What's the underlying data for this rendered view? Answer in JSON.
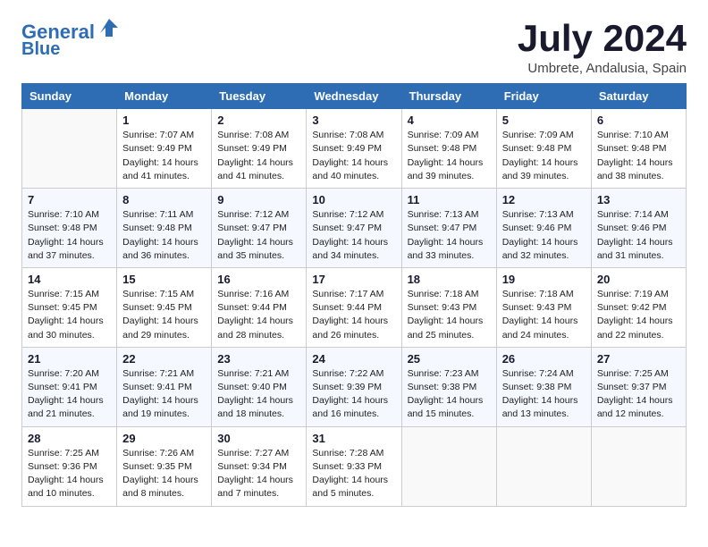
{
  "header": {
    "logo_line1": "General",
    "logo_line2": "Blue",
    "month_year": "July 2024",
    "location": "Umbrete, Andalusia, Spain"
  },
  "weekdays": [
    "Sunday",
    "Monday",
    "Tuesday",
    "Wednesday",
    "Thursday",
    "Friday",
    "Saturday"
  ],
  "weeks": [
    [
      {
        "day": "",
        "info": ""
      },
      {
        "day": "1",
        "info": "Sunrise: 7:07 AM\nSunset: 9:49 PM\nDaylight: 14 hours\nand 41 minutes."
      },
      {
        "day": "2",
        "info": "Sunrise: 7:08 AM\nSunset: 9:49 PM\nDaylight: 14 hours\nand 41 minutes."
      },
      {
        "day": "3",
        "info": "Sunrise: 7:08 AM\nSunset: 9:49 PM\nDaylight: 14 hours\nand 40 minutes."
      },
      {
        "day": "4",
        "info": "Sunrise: 7:09 AM\nSunset: 9:48 PM\nDaylight: 14 hours\nand 39 minutes."
      },
      {
        "day": "5",
        "info": "Sunrise: 7:09 AM\nSunset: 9:48 PM\nDaylight: 14 hours\nand 39 minutes."
      },
      {
        "day": "6",
        "info": "Sunrise: 7:10 AM\nSunset: 9:48 PM\nDaylight: 14 hours\nand 38 minutes."
      }
    ],
    [
      {
        "day": "7",
        "info": "Sunrise: 7:10 AM\nSunset: 9:48 PM\nDaylight: 14 hours\nand 37 minutes."
      },
      {
        "day": "8",
        "info": "Sunrise: 7:11 AM\nSunset: 9:48 PM\nDaylight: 14 hours\nand 36 minutes."
      },
      {
        "day": "9",
        "info": "Sunrise: 7:12 AM\nSunset: 9:47 PM\nDaylight: 14 hours\nand 35 minutes."
      },
      {
        "day": "10",
        "info": "Sunrise: 7:12 AM\nSunset: 9:47 PM\nDaylight: 14 hours\nand 34 minutes."
      },
      {
        "day": "11",
        "info": "Sunrise: 7:13 AM\nSunset: 9:47 PM\nDaylight: 14 hours\nand 33 minutes."
      },
      {
        "day": "12",
        "info": "Sunrise: 7:13 AM\nSunset: 9:46 PM\nDaylight: 14 hours\nand 32 minutes."
      },
      {
        "day": "13",
        "info": "Sunrise: 7:14 AM\nSunset: 9:46 PM\nDaylight: 14 hours\nand 31 minutes."
      }
    ],
    [
      {
        "day": "14",
        "info": "Sunrise: 7:15 AM\nSunset: 9:45 PM\nDaylight: 14 hours\nand 30 minutes."
      },
      {
        "day": "15",
        "info": "Sunrise: 7:15 AM\nSunset: 9:45 PM\nDaylight: 14 hours\nand 29 minutes."
      },
      {
        "day": "16",
        "info": "Sunrise: 7:16 AM\nSunset: 9:44 PM\nDaylight: 14 hours\nand 28 minutes."
      },
      {
        "day": "17",
        "info": "Sunrise: 7:17 AM\nSunset: 9:44 PM\nDaylight: 14 hours\nand 26 minutes."
      },
      {
        "day": "18",
        "info": "Sunrise: 7:18 AM\nSunset: 9:43 PM\nDaylight: 14 hours\nand 25 minutes."
      },
      {
        "day": "19",
        "info": "Sunrise: 7:18 AM\nSunset: 9:43 PM\nDaylight: 14 hours\nand 24 minutes."
      },
      {
        "day": "20",
        "info": "Sunrise: 7:19 AM\nSunset: 9:42 PM\nDaylight: 14 hours\nand 22 minutes."
      }
    ],
    [
      {
        "day": "21",
        "info": "Sunrise: 7:20 AM\nSunset: 9:41 PM\nDaylight: 14 hours\nand 21 minutes."
      },
      {
        "day": "22",
        "info": "Sunrise: 7:21 AM\nSunset: 9:41 PM\nDaylight: 14 hours\nand 19 minutes."
      },
      {
        "day": "23",
        "info": "Sunrise: 7:21 AM\nSunset: 9:40 PM\nDaylight: 14 hours\nand 18 minutes."
      },
      {
        "day": "24",
        "info": "Sunrise: 7:22 AM\nSunset: 9:39 PM\nDaylight: 14 hours\nand 16 minutes."
      },
      {
        "day": "25",
        "info": "Sunrise: 7:23 AM\nSunset: 9:38 PM\nDaylight: 14 hours\nand 15 minutes."
      },
      {
        "day": "26",
        "info": "Sunrise: 7:24 AM\nSunset: 9:38 PM\nDaylight: 14 hours\nand 13 minutes."
      },
      {
        "day": "27",
        "info": "Sunrise: 7:25 AM\nSunset: 9:37 PM\nDaylight: 14 hours\nand 12 minutes."
      }
    ],
    [
      {
        "day": "28",
        "info": "Sunrise: 7:25 AM\nSunset: 9:36 PM\nDaylight: 14 hours\nand 10 minutes."
      },
      {
        "day": "29",
        "info": "Sunrise: 7:26 AM\nSunset: 9:35 PM\nDaylight: 14 hours\nand 8 minutes."
      },
      {
        "day": "30",
        "info": "Sunrise: 7:27 AM\nSunset: 9:34 PM\nDaylight: 14 hours\nand 7 minutes."
      },
      {
        "day": "31",
        "info": "Sunrise: 7:28 AM\nSunset: 9:33 PM\nDaylight: 14 hours\nand 5 minutes."
      },
      {
        "day": "",
        "info": ""
      },
      {
        "day": "",
        "info": ""
      },
      {
        "day": "",
        "info": ""
      }
    ]
  ]
}
